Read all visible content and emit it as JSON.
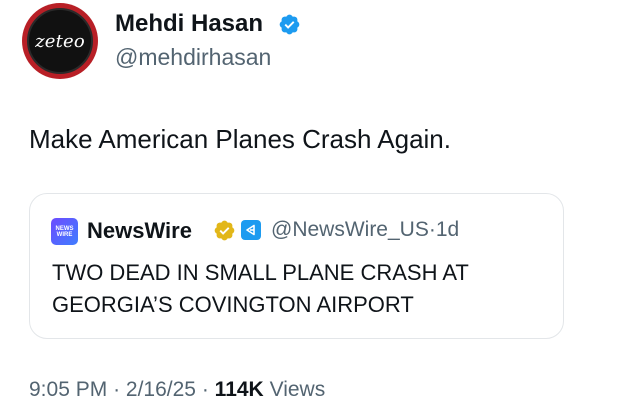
{
  "author": {
    "avatar_text": "zeteo",
    "display_name": "Mehdi Hasan",
    "handle": "@mehdirhasan",
    "verified_icon": "verified-badge-blue",
    "avatar_color": "#b81f26"
  },
  "tweet": {
    "text": "Make American Planes Crash Again."
  },
  "quoted": {
    "avatar_line1": "NEWS",
    "avatar_line2": "WIRE",
    "display_name": "NewsWire",
    "verified_icon": "verified-badge-gold",
    "affiliate_icon": "affiliate-badge",
    "handle": "@NewsWire_US",
    "separator": "·",
    "age": "1d",
    "headline_line1": "TWO DEAD IN SMALL PLANE CRASH AT",
    "headline_line2": "GEORGIA’S COVINGTON AIRPORT"
  },
  "footer": {
    "time": "9:05 PM",
    "date": "2/16/25",
    "views_count": "114K",
    "views_label": "Views",
    "separator": "·"
  },
  "colors": {
    "text": "#0f1419",
    "secondary": "#536471",
    "verified_blue": "#1d9bf0",
    "verified_gold": "#e2b719",
    "border": "#e3e6e9"
  }
}
